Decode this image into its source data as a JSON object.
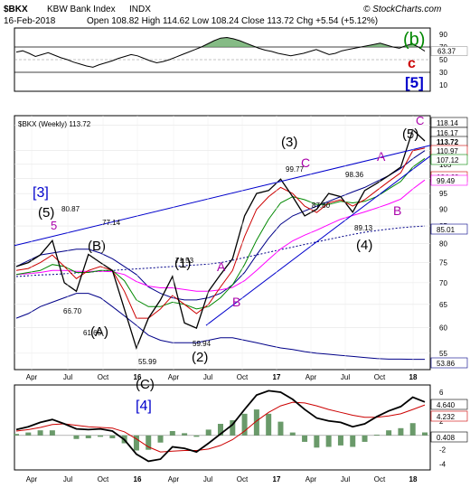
{
  "header": {
    "symbol": "$BKX",
    "name": "KBW Bank Index",
    "exchange": "INDX",
    "date": "16-Feb-2018",
    "ohlc_text": "Open 108.82  High 114.62  Low 108.24  Close 113.72  Chg +5.54 (+5.12%)",
    "copyright": "© StockCharts.com"
  },
  "colors": {
    "price": "#000000",
    "ma_short": "#cc0000",
    "ma_mid": "#008800",
    "ma_long": "#ff00ff",
    "trendline": "#0000cc",
    "band": "#000088",
    "rsi_fill": "#66aa66",
    "macd_hist": "#6a9a6a",
    "wave_label": "#000000",
    "wave_blue": "#0000cc",
    "wave_purple": "#aa00aa",
    "wave_red": "#cc0000",
    "wave_green": "#008800"
  },
  "chart_data": [
    {
      "type": "line",
      "panel": "rsi",
      "y_ticks": [
        10,
        30,
        50,
        70,
        90
      ],
      "ylim": [
        0,
        100
      ],
      "last_value_label": "63.37",
      "wave_labels": [
        {
          "text": "(b)",
          "color": "green"
        },
        {
          "text": "c",
          "color": "red"
        },
        {
          "text": "[5]",
          "color": "blue"
        }
      ],
      "series": [
        {
          "values": [
            62,
            64,
            60,
            55,
            58,
            61,
            57,
            53,
            50,
            46,
            43,
            40,
            38,
            42,
            45,
            48,
            52,
            55,
            58,
            56,
            52,
            48,
            45,
            47,
            50,
            54,
            58,
            62,
            66,
            70,
            75,
            80,
            84,
            85,
            83,
            80,
            76,
            72,
            68,
            65,
            63,
            60,
            58,
            56,
            58,
            60,
            63,
            66,
            62,
            58,
            60,
            64,
            66,
            68,
            70,
            72,
            74,
            76,
            73,
            70,
            68,
            72,
            75,
            70,
            63.37
          ]
        }
      ]
    },
    {
      "type": "line",
      "panel": "price",
      "legend": "$BKX (Weekly) 113.72",
      "y_scale": "log",
      "y_ticks": [
        55,
        60,
        65,
        70,
        75,
        80,
        85,
        90,
        95,
        100,
        105,
        110,
        120
      ],
      "ylim": [
        52,
        124
      ],
      "x_ticks": [
        "Apr",
        "Jul",
        "Oct",
        "16",
        "Apr",
        "Jul",
        "Oct",
        "17",
        "Apr",
        "Jul",
        "Oct",
        "18"
      ],
      "price_labels": [
        "118.14",
        "116.17",
        "113.72",
        "110.97",
        "107.12",
        "104.60",
        "99.49",
        "85.01",
        "53.86"
      ],
      "point_labels": [
        "99.77",
        "98.36",
        "87.80",
        "89.13",
        "80.87",
        "77.14",
        "71.53",
        "66.70",
        "61.65",
        "59.94",
        "55.99"
      ],
      "wave_labels": [
        "[3]",
        "(5)",
        "5",
        "(B)",
        "(A)",
        "(1)",
        "A",
        "B",
        "(2)",
        "(3)",
        "C",
        "A",
        "B",
        "(4)",
        "(5)",
        "C",
        "(C)",
        "[4]"
      ],
      "x": [
        "2015-04",
        "2015-05",
        "2015-06",
        "2015-07",
        "2015-08",
        "2015-09",
        "2015-10",
        "2015-11",
        "2015-12",
        "2016-01",
        "2016-02",
        "2016-03",
        "2016-04",
        "2016-05",
        "2016-06",
        "2016-07",
        "2016-08",
        "2016-09",
        "2016-10",
        "2016-11",
        "2016-12",
        "2017-01",
        "2017-02",
        "2017-03",
        "2017-04",
        "2017-05",
        "2017-06",
        "2017-07",
        "2017-08",
        "2017-09",
        "2017-10",
        "2017-11",
        "2017-12",
        "2018-01",
        "2018-02"
      ],
      "series": [
        {
          "name": "$BKX",
          "values": [
            74,
            75,
            77,
            80.87,
            70,
            68,
            77.14,
            75,
            73,
            64,
            55.99,
            62,
            66,
            71.53,
            61,
            59.94,
            68,
            72,
            76,
            88,
            95,
            96,
            99.77,
            94,
            88,
            90,
            95,
            94,
            89.13,
            96,
            98.36,
            101,
            104,
            118.14,
            113.72
          ]
        },
        {
          "values": [
            73,
            73.5,
            75,
            77,
            74,
            71,
            73,
            74,
            73,
            68,
            62,
            62,
            64,
            67,
            65,
            63,
            65,
            69,
            73,
            82,
            90,
            94,
            97,
            95,
            91,
            89,
            92,
            93,
            91,
            93,
            96,
            99,
            102,
            110,
            110.97
          ]
        },
        {
          "values": [
            72,
            72.5,
            73,
            74.5,
            74,
            72.5,
            72.5,
            73,
            73,
            70.5,
            66,
            64.5,
            64.5,
            65.5,
            65,
            64,
            64.5,
            66.5,
            69.5,
            74.5,
            81,
            87,
            92,
            94,
            93,
            91.5,
            91.5,
            92.5,
            92,
            92.5,
            94,
            96.5,
            99,
            104,
            107.12
          ]
        },
        {
          "values": [
            72,
            72.2,
            72.5,
            73,
            73,
            72.8,
            72.8,
            72.8,
            72.7,
            72,
            70.3,
            69.2,
            68.8,
            68.8,
            68.4,
            68,
            68,
            68.3,
            68.9,
            70.5,
            73,
            75.8,
            78.6,
            80.8,
            82.4,
            83.8,
            85.4,
            87,
            88.1,
            89.2,
            90.4,
            91.7,
            93.2,
            96.5,
            99.49
          ]
        },
        {
          "values": [
            74,
            75.5,
            77,
            77.5,
            78,
            78.5,
            78.5,
            77.5,
            76,
            74,
            72,
            69,
            67.5,
            66.5,
            66,
            66,
            66.5,
            67.5,
            69.5,
            72.5,
            77,
            81.5,
            85.5,
            88,
            89.5,
            91,
            92.5,
            94,
            95.5,
            97,
            99,
            101,
            103.5,
            107,
            110
          ]
        },
        {
          "values": [
            62,
            63,
            64.5,
            65.5,
            66.5,
            67.5,
            67.5,
            66.5,
            64.5,
            62.5,
            60.5,
            58.5,
            57.5,
            57,
            57,
            57,
            57.5,
            58,
            58,
            57.5,
            57,
            56.5,
            56,
            55.7,
            55.3,
            55,
            54.8,
            54.6,
            54.4,
            54.2,
            54,
            53.9,
            53.9,
            53.86,
            53.86
          ]
        },
        {
          "values": [
            71.5,
            71.7,
            71.9,
            72,
            72.2,
            72.4,
            72.6,
            72.8,
            73,
            73.2,
            73.4,
            73.6,
            73.8,
            74,
            74.2,
            74.4,
            74.6,
            75,
            75.6,
            76.3,
            77,
            77.7,
            78.4,
            79.1,
            79.8,
            80.5,
            81.2,
            81.9,
            82.6,
            83.2,
            83.7,
            84.1,
            84.5,
            84.8,
            85.01
          ]
        }
      ]
    },
    {
      "type": "line",
      "panel": "macd",
      "y_ticks": [
        -4,
        -2,
        0,
        2,
        4,
        6
      ],
      "ylim": [
        -4.8,
        7
      ],
      "value_labels": [
        "4.640",
        "4.232",
        "0.408"
      ],
      "series": [
        {
          "values": [
            0.8,
            1.2,
            1.8,
            2.2,
            1.6,
            0.9,
            0.8,
            0.9,
            0.6,
            -0.6,
            -2.6,
            -3.6,
            -3.3,
            -1.6,
            -1.8,
            -2.3,
            -1.1,
            0.2,
            1.5,
            3.6,
            5.6,
            6.2,
            6.0,
            5.0,
            3.6,
            2.4,
            2.0,
            1.8,
            1.2,
            1.6,
            2.6,
            3.4,
            4.0,
            5.3,
            4.64
          ]
        },
        {
          "values": [
            0.6,
            0.8,
            1.1,
            1.5,
            1.6,
            1.4,
            1.2,
            1.1,
            1.0,
            0.5,
            -0.5,
            -1.6,
            -2.3,
            -2.2,
            -2.1,
            -2.1,
            -1.9,
            -1.4,
            -0.6,
            0.6,
            2.0,
            3.2,
            4.1,
            4.6,
            4.5,
            4.1,
            3.6,
            3.2,
            2.8,
            2.5,
            2.5,
            2.7,
            3.0,
            3.6,
            4.232
          ]
        },
        {
          "values": [
            0.2,
            0.4,
            0.7,
            0.7,
            0.0,
            -0.5,
            -0.4,
            -0.2,
            -0.4,
            -1.1,
            -2.1,
            -2.0,
            -1.0,
            0.6,
            0.3,
            -0.2,
            0.8,
            1.6,
            2.1,
            3.0,
            3.6,
            3.0,
            1.9,
            0.4,
            -0.9,
            -1.7,
            -1.6,
            -1.4,
            -1.6,
            -0.9,
            0.1,
            0.7,
            1.0,
            1.7,
            0.408
          ]
        }
      ]
    }
  ]
}
